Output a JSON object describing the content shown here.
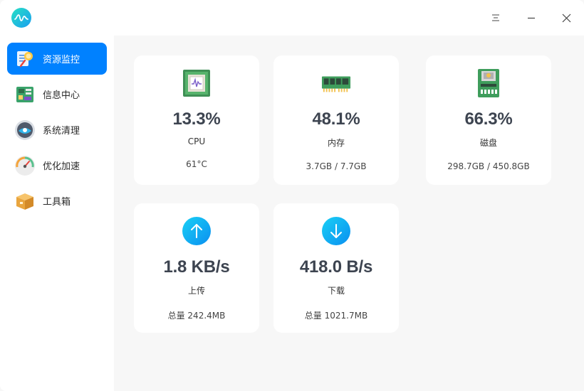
{
  "titlebar": {
    "logo_icon": "pulse-wave-icon",
    "menu_icon": "hamburger-menu-icon",
    "minimize_icon": "minimize-icon",
    "close_icon": "close-icon"
  },
  "sidebar": {
    "items": [
      {
        "label": "资源监控",
        "icon": "resource-monitor-icon",
        "active": true
      },
      {
        "label": "信息中心",
        "icon": "circuit-board-icon",
        "active": false
      },
      {
        "label": "系统清理",
        "icon": "cleanup-disc-icon",
        "active": false
      },
      {
        "label": "优化加速",
        "icon": "speedometer-icon",
        "active": false
      },
      {
        "label": "工具箱",
        "icon": "toolbox-icon",
        "active": false
      }
    ]
  },
  "cards": {
    "cpu": {
      "value": "13.3%",
      "label": "CPU",
      "sub": "61°C",
      "icon": "cpu-chip-icon"
    },
    "memory": {
      "value": "48.1%",
      "label": "内存",
      "sub": "3.7GB / 7.7GB",
      "icon": "memory-stick-icon"
    },
    "disk": {
      "value": "66.3%",
      "label": "磁盘",
      "sub": "298.7GB / 450.8GB",
      "icon": "sd-card-icon"
    },
    "upload": {
      "value": "1.8 KB/s",
      "label": "上传",
      "sub": "总量 242.4MB",
      "icon": "arrow-up-icon"
    },
    "download": {
      "value": "418.0 B/s",
      "label": "下载",
      "sub": "总量 1021.7MB",
      "icon": "arrow-down-icon"
    }
  },
  "colors": {
    "accent": "#0081ff",
    "card_value": "#3d4450",
    "network_icon_gradient": [
      "#1ad0f5",
      "#0a8ff0"
    ]
  }
}
